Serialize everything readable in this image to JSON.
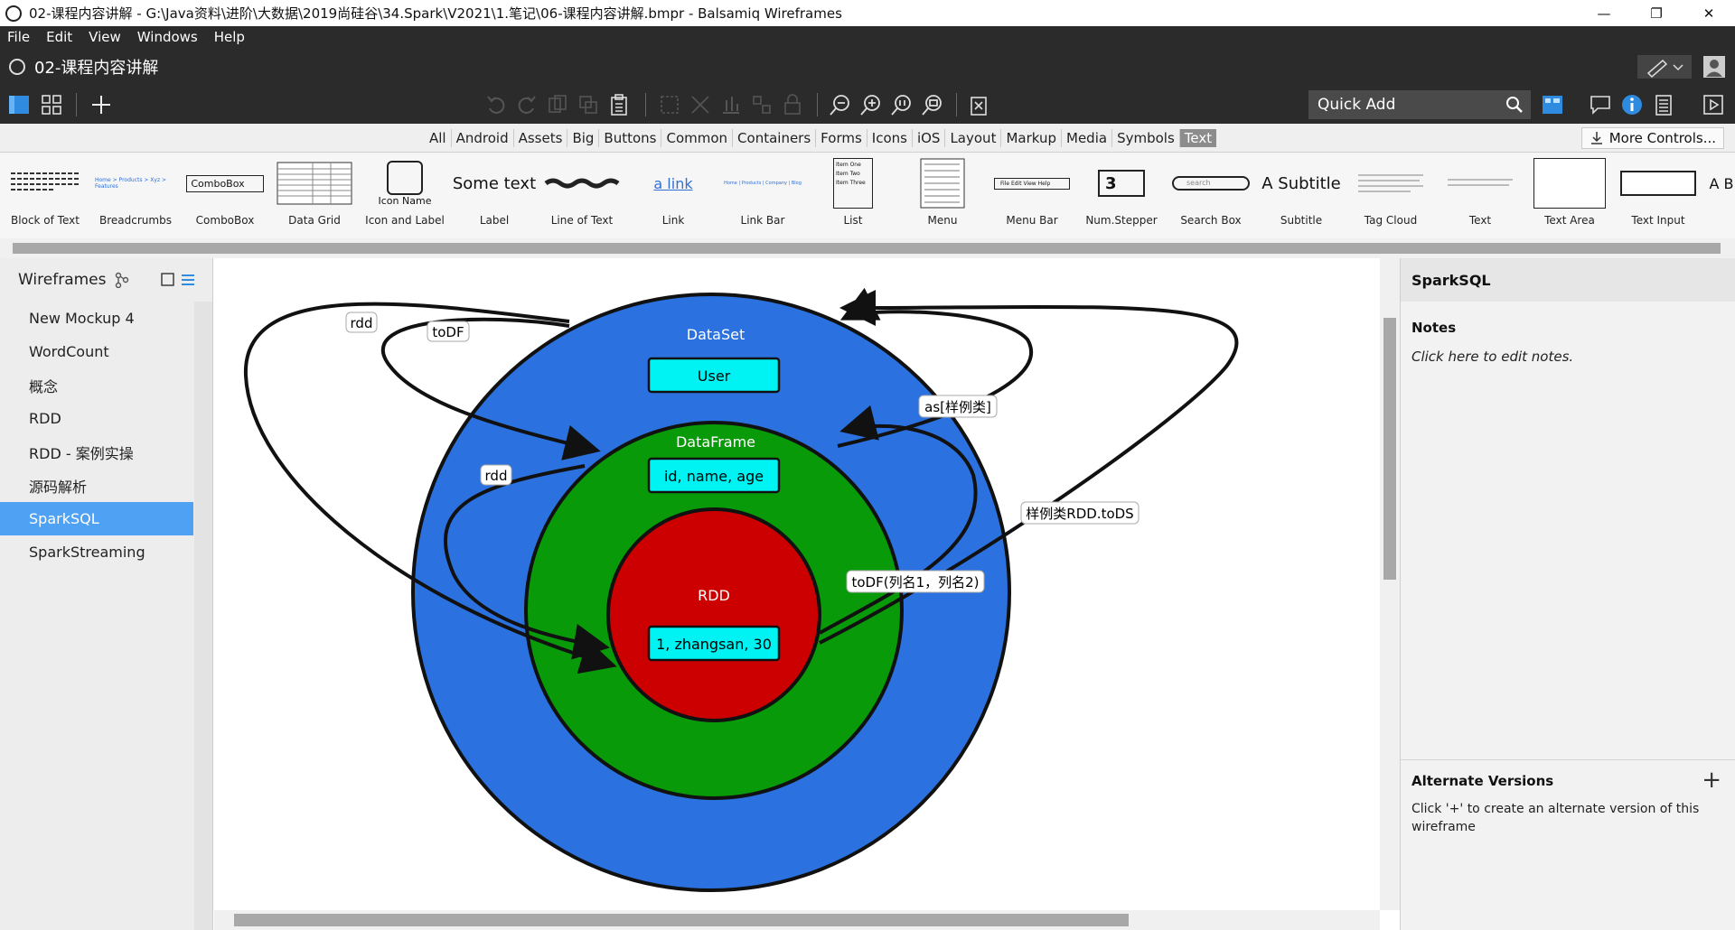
{
  "window": {
    "title": "02-课程内容讲解 - G:\\Java资料\\进阶\\大数据\\2019尚硅谷\\34.Spark\\V2021\\1.笔记\\06-课程内容讲解.bmpr - Balsamiq Wireframes",
    "minimize": "—",
    "restore": "❐",
    "close": "✕"
  },
  "menu": [
    "File",
    "Edit",
    "View",
    "Windows",
    "Help"
  ],
  "document": {
    "title": "02-课程内容讲解"
  },
  "quick_add": {
    "placeholder": "Quick Add"
  },
  "categories": {
    "items": [
      "All",
      "Android",
      "Assets",
      "Big",
      "Buttons",
      "Common",
      "Containers",
      "Forms",
      "Icons",
      "iOS",
      "Layout",
      "Markup",
      "Media",
      "Symbols",
      "Text"
    ],
    "active": "Text",
    "more": "More Controls..."
  },
  "library": [
    {
      "label": "Block of Text"
    },
    {
      "label": "Breadcrumbs",
      "text": "Home > Products > Xyz > Features"
    },
    {
      "label": "ComboBox",
      "text": "ComboBox"
    },
    {
      "label": "Data Grid"
    },
    {
      "label": "Icon and Label",
      "text": "Icon Name"
    },
    {
      "label": "Label",
      "text": "Some text"
    },
    {
      "label": "Line of Text"
    },
    {
      "label": "Link",
      "text": "a link"
    },
    {
      "label": "Link Bar",
      "text": "Home | Products | Company | Blog"
    },
    {
      "label": "List",
      "text": "Item One Item Two Item Three"
    },
    {
      "label": "Menu"
    },
    {
      "label": "Menu Bar",
      "text": "File Edit View Help"
    },
    {
      "label": "Num.Stepper",
      "text": "3"
    },
    {
      "label": "Search Box",
      "text": "search"
    },
    {
      "label": "Subtitle",
      "text": "A Subtitle"
    },
    {
      "label": "Tag Cloud"
    },
    {
      "label": "Text"
    },
    {
      "label": "Text Area"
    },
    {
      "label": "Text Input"
    },
    {
      "label": "",
      "text": "A B"
    }
  ],
  "wireframes": {
    "header": "Wireframes",
    "items": [
      "New Mockup 4",
      "WordCount",
      "概念",
      "RDD",
      "RDD - 案例实操",
      "源码解析",
      "SparkSQL",
      "SparkStreaming"
    ],
    "selected": "SparkSQL"
  },
  "diagram": {
    "colors": {
      "dataset": "#2b72e0",
      "dataframe": "#089a08",
      "rdd": "#cc0000",
      "box": "#00f3f3"
    },
    "dataset": {
      "title": "DataSet",
      "field": "User"
    },
    "dataframe": {
      "title": "DataFrame",
      "field": "id, name, age"
    },
    "rdd": {
      "title": "RDD",
      "field": "1, zhangsan, 30"
    },
    "arrow_labels": {
      "rdd_top": "rdd",
      "todf_top": "toDF",
      "rdd_mid": "rdd",
      "as_case": "as[样例类]",
      "case_rdd_tods": "样例类RDD.toDS",
      "todf_cols": "toDF(列名1，列名2)"
    }
  },
  "inspector": {
    "title": "SparkSQL",
    "notes_heading": "Notes",
    "notes_placeholder": "Click here to edit notes.",
    "alt_heading": "Alternate Versions",
    "alt_text": "Click '+' to create an alternate version of this wireframe",
    "plus": "+"
  }
}
